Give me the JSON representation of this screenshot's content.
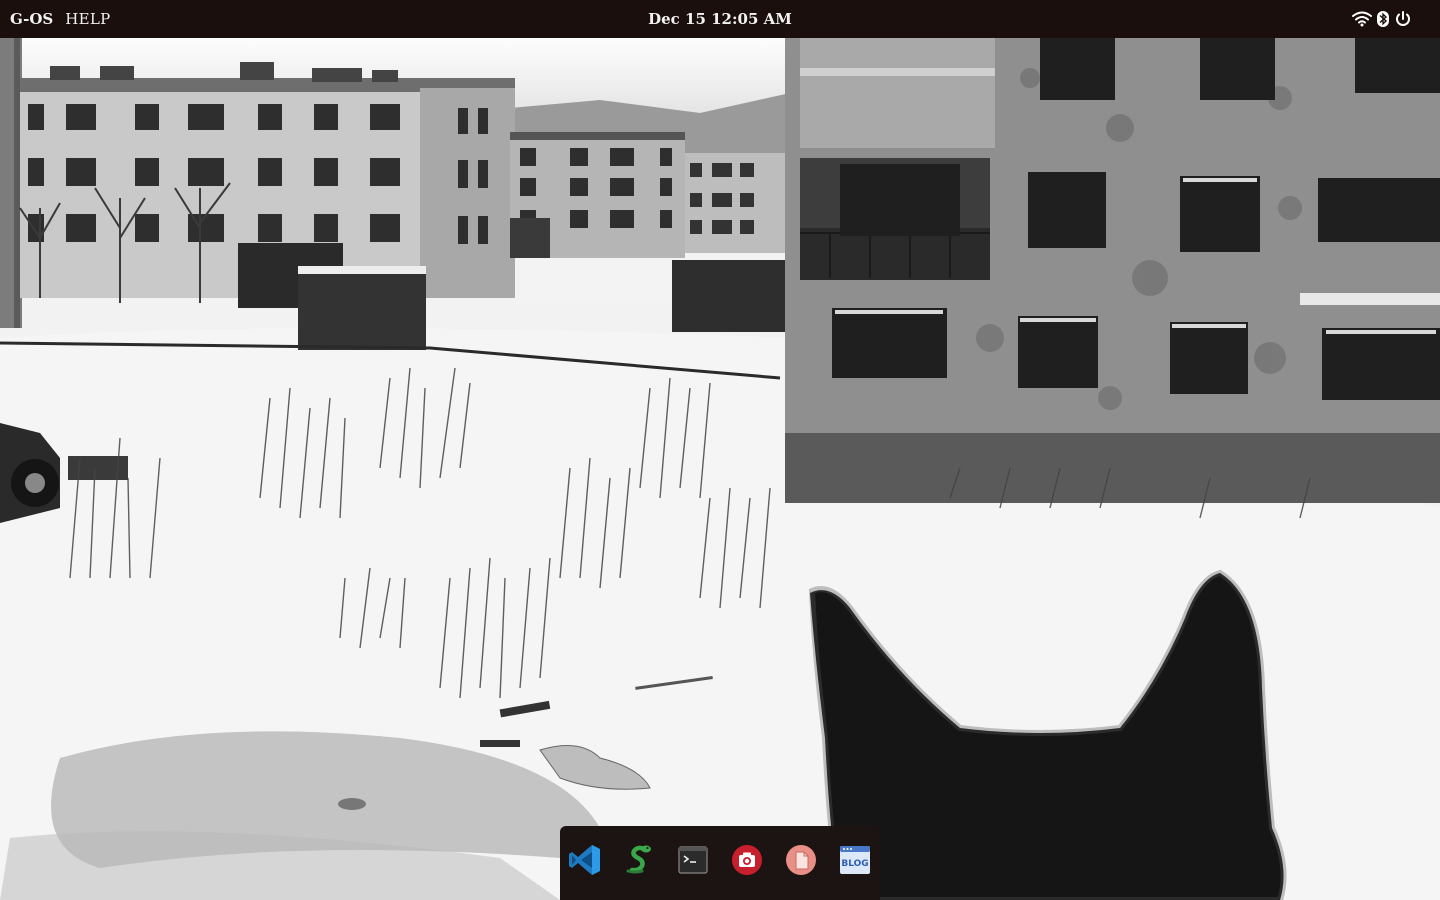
{
  "topbar": {
    "logo": "G-OS",
    "help": "HELP",
    "clock": "Dec 15 12:05 AM",
    "icons": [
      "wifi-icon",
      "bluetooth-icon",
      "power-icon"
    ]
  },
  "desktop": {
    "wallpaper": "black-and-white snowy courtyard with abandoned apartment buildings and a cat silhouette"
  },
  "dock": {
    "apps": [
      {
        "name": "vscode",
        "icon": "vscode-icon",
        "accent": "#2c8ed6"
      },
      {
        "name": "python-snake",
        "icon": "snake-icon",
        "accent": "#3aa84a"
      },
      {
        "name": "terminal",
        "icon": "terminal-icon",
        "accent": "#2b2b2b"
      },
      {
        "name": "camera",
        "icon": "camera-icon",
        "accent": "#c81f2e"
      },
      {
        "name": "files",
        "icon": "file-icon",
        "accent": "#e88f86"
      },
      {
        "name": "blog",
        "icon": "blog-icon",
        "label": "BLOG",
        "accent": "#2b5fb4"
      }
    ]
  },
  "colors": {
    "topbar_bg": "#1a0f0c",
    "dock_bg": "#1c1412",
    "topbar_text": "#f2f2f2"
  }
}
